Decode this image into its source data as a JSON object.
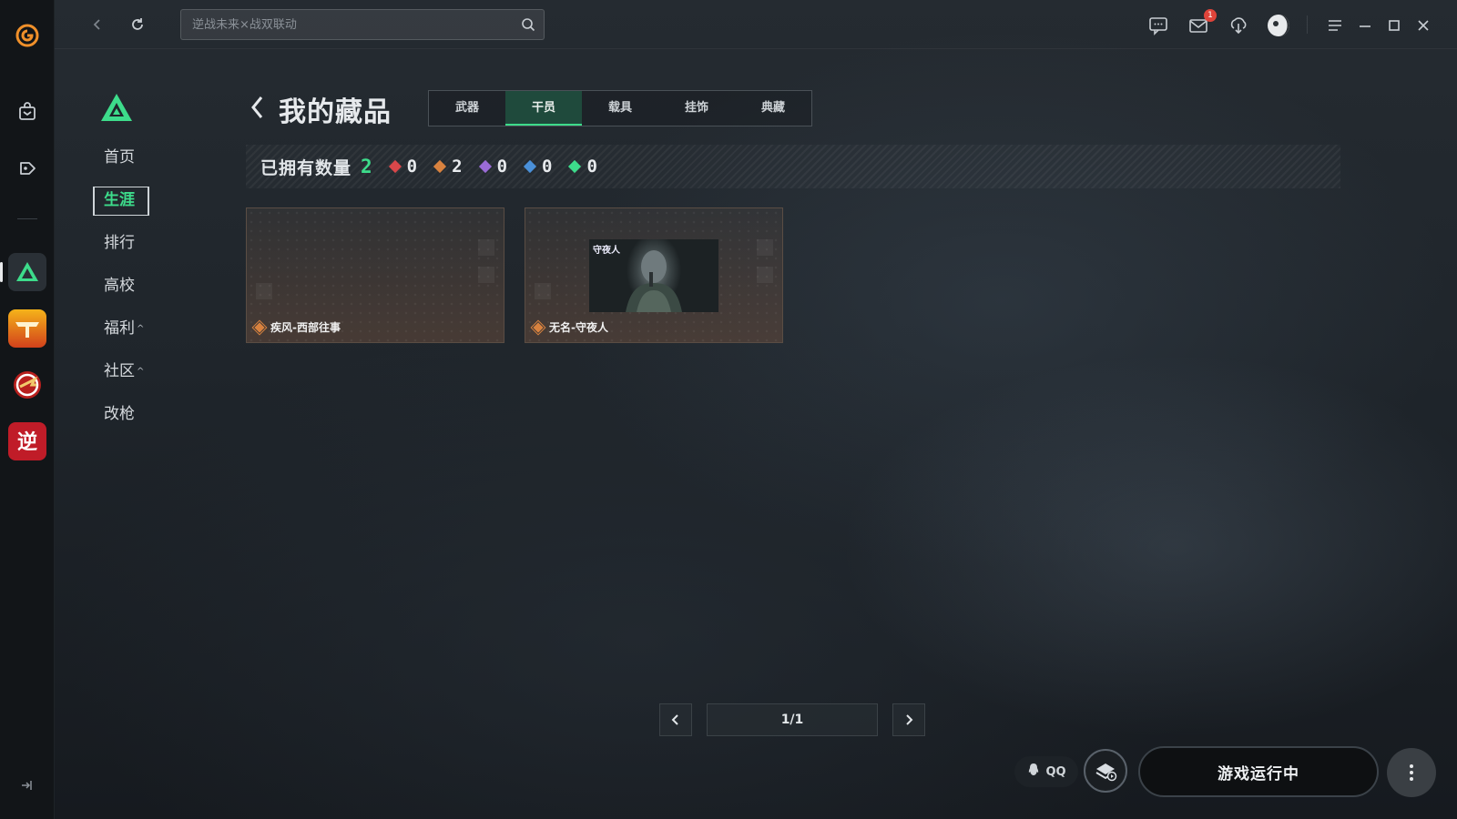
{
  "topbar": {
    "search_placeholder": "逆战未来×战双联动",
    "mail_badge": "1"
  },
  "subnav": {
    "items": [
      {
        "label": "首页",
        "caret": ""
      },
      {
        "label": "生涯",
        "caret": ""
      },
      {
        "label": "排行",
        "caret": ""
      },
      {
        "label": "高校",
        "caret": ""
      },
      {
        "label": "福利",
        "caret": "^"
      },
      {
        "label": "社区",
        "caret": "^"
      },
      {
        "label": "改枪",
        "caret": ""
      }
    ],
    "active_index": 1
  },
  "page": {
    "title": "我的藏品",
    "tabs": [
      "武器",
      "干员",
      "载具",
      "挂饰",
      "典藏"
    ],
    "active_tab": 1
  },
  "stats": {
    "label": "已拥有数量",
    "total": "2",
    "rarities": [
      {
        "color": "#d9474a",
        "count": "0"
      },
      {
        "color": "#d9823f",
        "count": "2"
      },
      {
        "color": "#9a6bd6",
        "count": "0"
      },
      {
        "color": "#4a90d9",
        "count": "0"
      },
      {
        "color": "#3ddc8b",
        "count": "0"
      }
    ]
  },
  "cards": [
    {
      "name": "疾风-西部往事",
      "rarity_color": "#d9823f",
      "has_thumb": false
    },
    {
      "name": "无名-守夜人",
      "rarity_color": "#d9823f",
      "has_thumb": true,
      "thumb_text": "守夜人"
    }
  ],
  "pagination": {
    "display": "1/1"
  },
  "bottom": {
    "qq_label": "QQ",
    "launch_label": "游戏运行中"
  },
  "colors": {
    "accent": "#3ddc8b",
    "background": "#1b2026"
  },
  "icons": {
    "rail": [
      "app-logo-icon",
      "bag-icon",
      "gamepad-tag-icon",
      "game-triangle-icon",
      "game-wings-icon",
      "game-cf-icon",
      "game-ni-icon"
    ],
    "top": [
      "chat-icon",
      "mail-icon",
      "download-icon",
      "avatar",
      "menu-icon",
      "minimize-icon",
      "maximize-icon",
      "close-icon"
    ]
  }
}
